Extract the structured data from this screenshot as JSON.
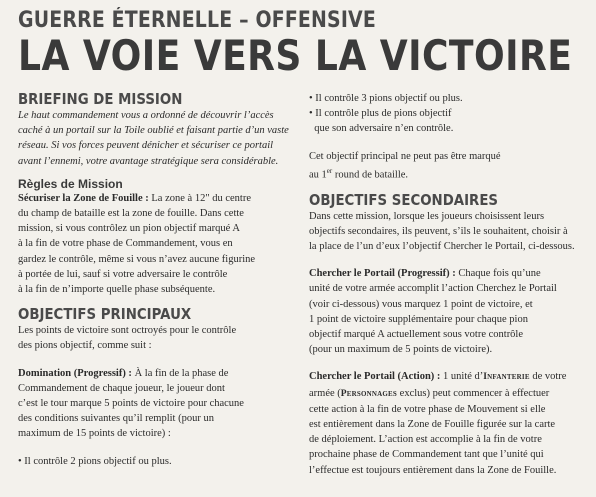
{
  "supertitle": "GUERRE ÉTERNELLE – OFFENSIVE",
  "title": "LA VOIE VERS LA VICTOIRE",
  "left": {
    "briefing_heading": "BRIEFING DE MISSION",
    "briefing_lines": [
      "Le haut commandement vous a ordonné de découvrir l’accès",
      "caché à un portail sur la Toile oublié et faisant partie d’un vaste",
      "réseau. Si vos forces peuvent dénicher et sécuriser ce portail",
      "avant l’ennemi, votre avantage stratégique sera considérable."
    ],
    "rules_heading": "Règles de Mission",
    "rules_bold": "Sécuriser la Zone de Fouille :",
    "rules_lines_first": " La zone à 12\" du centre",
    "rules_lines": [
      "du champ de bataille est la zone de fouille. Dans cette",
      "mission, si vous contrôlez un pion objectif marqué A",
      "à la fin de votre phase de Commandement, vous en",
      "gardez le contrôle, même si vous n’avez aucune figurine",
      "à portée de lui, sauf si votre adversaire le contrôle",
      "à la fin de n’importe quelle phase subséquente."
    ],
    "primary_heading": "OBJECTIFS PRINCIPAUX",
    "primary_intro": [
      "Les points de victoire sont octroyés pour le contrôle",
      "des pions objectif, comme suit :"
    ],
    "domination_bold": "Domination (Progressif) :",
    "domination_first": " À la fin de la phase de",
    "domination_lines": [
      "Commandement de chaque joueur, le joueur dont",
      "c’est le tour marque 5 points de victoire pour chacune",
      "des conditions suivantes qu’il remplit (pour un",
      "maximum de 15 points de victoire) :"
    ],
    "bullet_1": "• Il contrôle 2 pions objectif ou plus."
  },
  "right": {
    "bullet_2": "• Il contrôle 3 pions objectif ou plus.",
    "bullet_3_a": "• Il contrôle plus de pions objectif",
    "bullet_3_b": "  que son adversaire n’en contrôle.",
    "note_a": "Cet objectif principal ne peut pas être marqué",
    "note_b_pre": "au 1",
    "note_b_sup": "er",
    "note_b_post": " round de bataille.",
    "secondary_heading": "OBJECTIFS SECONDAIRES",
    "secondary_lines": [
      "Dans cette mission, lorsque les joueurs choisissent leurs",
      "objectifs secondaires, ils peuvent, s’ils le souhaitent, choisir à",
      "la place de l’un d’eux l’objectif Chercher le Portail, ci-dessous."
    ],
    "prog_bold": "Chercher le Portail (Progressif) :",
    "prog_first": " Chaque fois qu’une",
    "prog_lines": [
      "unité de votre armée accomplit l’action Cherchez le Portail",
      "(voir ci-dessous) vous marquez 1 point de victoire, et",
      "1 point de victoire supplémentaire pour chaque pion",
      "objectif marqué A actuellement sous votre contrôle",
      "(pour un maximum de 5 points de victoire)."
    ],
    "action_bold": "Chercher le Portail (Action) :",
    "action_first_a": " 1 unité d’",
    "action_kw1": "Infanterie",
    "action_first_b": " de votre",
    "action_second_a": "armée (",
    "action_kw2": "Personnages",
    "action_second_b": " exclus) peut commencer à effectuer",
    "action_lines": [
      "cette action à la fin de votre phase de Mouvement si elle",
      "est entièrement dans la Zone de Fouille figurée sur la carte",
      "de déploiement. L’action est accomplie à la fin de votre",
      "prochaine phase de Commandement tant que l’unité qui",
      "l’effectue est toujours entièrement dans la Zone de Fouille."
    ]
  }
}
